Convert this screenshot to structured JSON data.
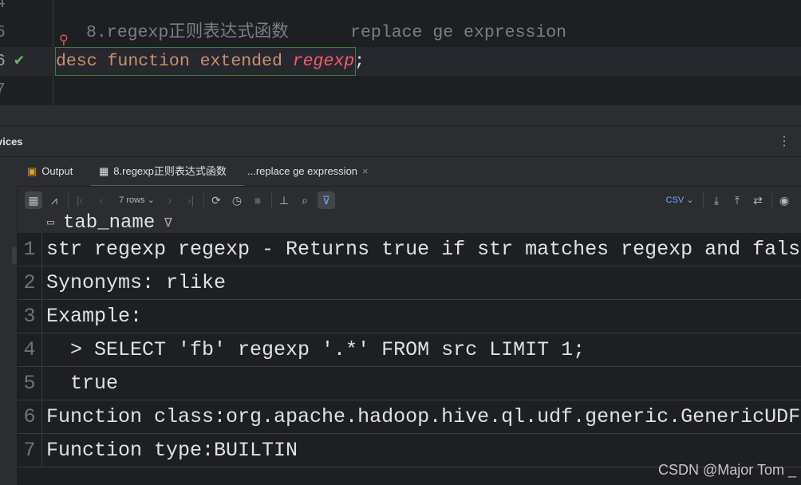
{
  "editor": {
    "lines": [
      {
        "num": "4",
        "text": ""
      },
      {
        "num": "5",
        "comment": "8.regexp正则表达式函数      replace ge expression"
      },
      {
        "num": "6",
        "keywords": "desc function extended ",
        "fn": "regexp",
        "end": ";"
      },
      {
        "num": "7",
        "text": ""
      }
    ]
  },
  "services": {
    "title": "vices"
  },
  "tabs": [
    {
      "label": "Output",
      "icon": "console-icon"
    },
    {
      "label": "8.regexp正则表达式函数",
      "icon": "table-icon"
    },
    {
      "label": "...replace ge expression",
      "icon": "close-icon"
    }
  ],
  "toolbar": {
    "rows_label": "7 rows",
    "export_format": "CSV"
  },
  "grid": {
    "column": "tab_name",
    "rows": [
      {
        "n": "1",
        "v": "str regexp regexp - Returns true if str matches regexp and false otherwise"
      },
      {
        "n": "2",
        "v": "Synonyms: rlike"
      },
      {
        "n": "3",
        "v": "Example:"
      },
      {
        "n": "4",
        "v": "  > SELECT 'fb' regexp '.*' FROM src LIMIT 1;"
      },
      {
        "n": "5",
        "v": "  true"
      },
      {
        "n": "6",
        "v": "Function class:org.apache.hadoop.hive.ql.udf.generic.GenericUDFRegExp"
      },
      {
        "n": "7",
        "v": "Function type:BUILTIN"
      }
    ]
  },
  "watermark": "CSDN @Major Tom _"
}
